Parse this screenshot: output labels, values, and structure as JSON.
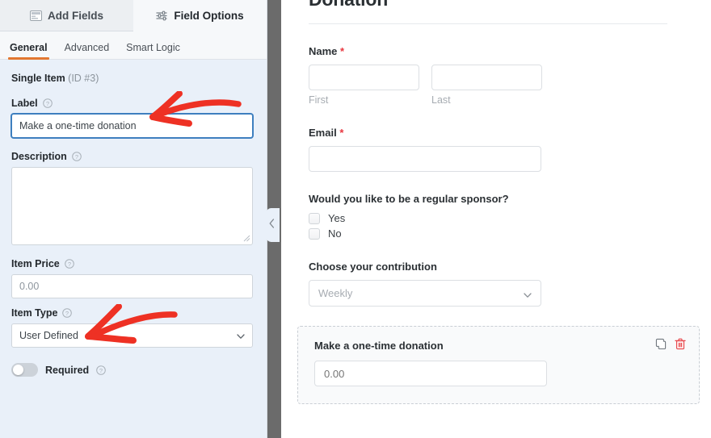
{
  "panel": {
    "tabs": [
      {
        "label": "Add Fields",
        "icon": "fields-grid-icon",
        "active": false
      },
      {
        "label": "Field Options",
        "icon": "sliders-icon",
        "active": true
      }
    ],
    "sub_tabs": [
      {
        "label": "General",
        "active": true
      },
      {
        "label": "Advanced",
        "active": false
      },
      {
        "label": "Smart Logic",
        "active": false
      }
    ],
    "field_heading": {
      "name": "Single Item",
      "id": "(ID #3)"
    },
    "options": {
      "label": {
        "label": "Label",
        "value": "Make a one-time donation",
        "help_icon": "question-circle-icon"
      },
      "description": {
        "label": "Description",
        "value": "",
        "placeholder": "",
        "help_icon": "question-circle-icon"
      },
      "item_price": {
        "label": "Item Price",
        "value": "",
        "placeholder": "0.00",
        "help_icon": "question-circle-icon"
      },
      "item_type": {
        "label": "Item Type",
        "value": "User Defined",
        "help_icon": "question-circle-icon",
        "chevron": "chevron-down-icon"
      },
      "required": {
        "label": "Required",
        "state": "off",
        "help_icon": "question-circle-icon"
      }
    }
  },
  "collapse": {
    "icon": "chevron-left-icon"
  },
  "preview": {
    "form_title": "Donation",
    "fields": {
      "name": {
        "label": "Name",
        "required_mark": "*",
        "first": {
          "value": "",
          "sublabel": "First"
        },
        "last": {
          "value": "",
          "sublabel": "Last"
        }
      },
      "email": {
        "label": "Email",
        "required_mark": "*",
        "value": ""
      },
      "sponsor": {
        "label": "Would you like to be a regular sponsor?",
        "choices": [
          {
            "label": "Yes",
            "checked": false
          },
          {
            "label": "No",
            "checked": false
          }
        ]
      },
      "contribution": {
        "label": "Choose your contribution",
        "selected": "Weekly",
        "chevron": "chevron-down-icon"
      },
      "single_item": {
        "label": "Make a one-time donation",
        "placeholder": "0.00",
        "value": "",
        "actions": [
          {
            "name": "duplicate-field-button",
            "icon": "copy-icon"
          },
          {
            "name": "delete-field-button",
            "icon": "trash-icon"
          }
        ]
      }
    }
  },
  "annotations": {
    "arrow_label": "red-arrow-pointing-to-label-input",
    "arrow_item_type": "red-arrow-pointing-to-item-type-select"
  },
  "colors": {
    "accent_orange": "#e27730",
    "panel_bg": "#e9f0f9",
    "separator": "#6b6b6b",
    "required_red": "#e8363f",
    "annotation_red": "#ee3124",
    "focus_blue": "#3e7fbf"
  }
}
